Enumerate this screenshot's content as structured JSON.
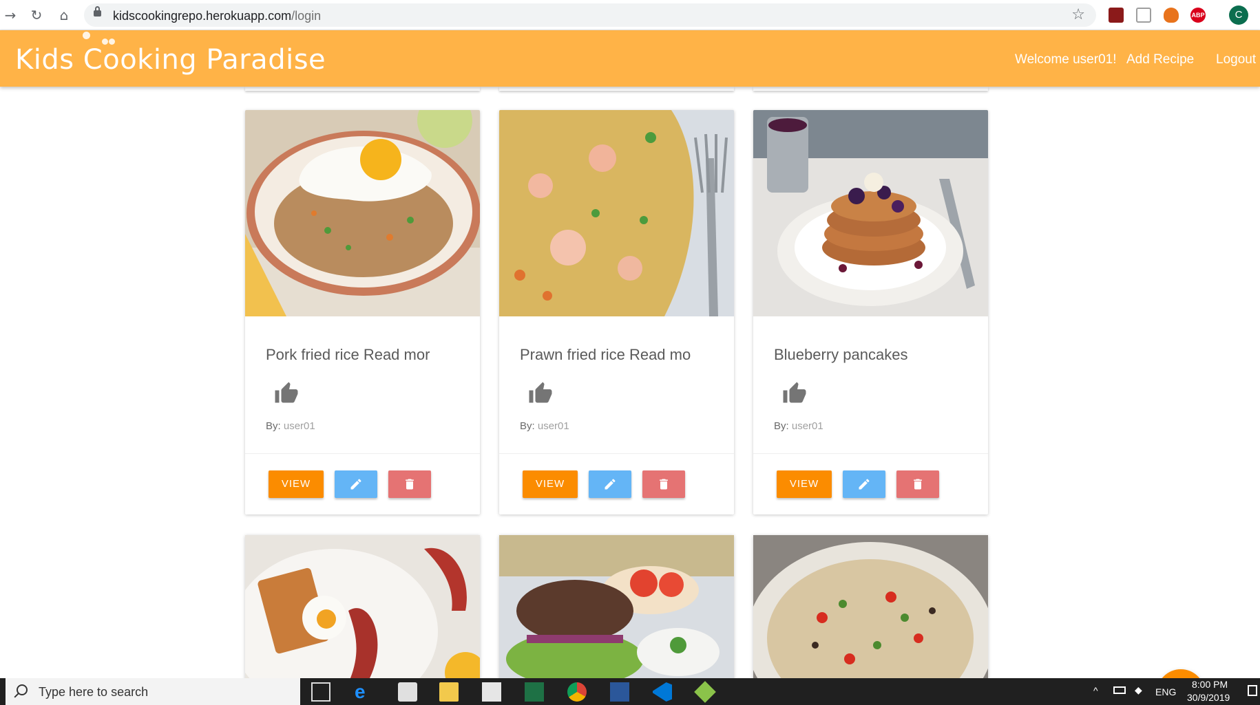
{
  "browser": {
    "url_host": "kidscookingrepo.herokuapp.com",
    "url_path": "/login",
    "profile_initial": "C",
    "extensions": [
      "pdf-icon",
      "document-icon",
      "fox-icon",
      "adblock-icon"
    ],
    "adblock_label": "ABP"
  },
  "header": {
    "brand": "Kids Cooking Paradise",
    "welcome": "Welcome user01!",
    "add_recipe": "Add Recipe",
    "logout": "Logout",
    "color": "#ffb347"
  },
  "cards": [
    {
      "title": "Pork fried rice Read mor",
      "by_label": "By:",
      "author": "user01",
      "view_label": "VIEW"
    },
    {
      "title": "Prawn fried rice Read mo",
      "by_label": "By:",
      "author": "user01",
      "view_label": "VIEW"
    },
    {
      "title": "Blueberry pancakes",
      "by_label": "By:",
      "author": "user01",
      "view_label": "VIEW"
    }
  ],
  "fab_label": "+",
  "colors": {
    "view": "#fb8c00",
    "edit": "#64b5f6",
    "delete": "#e57373"
  },
  "taskbar": {
    "search_placeholder": "Type here to search",
    "language": "ENG",
    "time": "8:00 PM",
    "date": "30/9/2019"
  }
}
